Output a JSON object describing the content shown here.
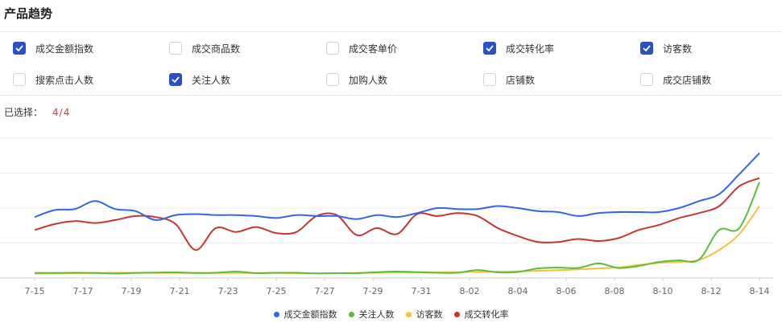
{
  "title": "产品趋势",
  "options": [
    {
      "label": "成交金额指数",
      "checked": true
    },
    {
      "label": "成交商品数",
      "checked": false
    },
    {
      "label": "成交客单价",
      "checked": false
    },
    {
      "label": "成交转化率",
      "checked": true
    },
    {
      "label": "访客数",
      "checked": true
    },
    {
      "label": "搜索点击人数",
      "checked": false
    },
    {
      "label": "关注人数",
      "checked": true
    },
    {
      "label": "加购人数",
      "checked": false
    },
    {
      "label": "店铺数",
      "checked": false
    },
    {
      "label": "成交店铺数",
      "checked": false
    }
  ],
  "selection": {
    "label": "已选择：",
    "count": "4/4"
  },
  "colors": {
    "checkbox": "#2a50c8",
    "count": "#e0383e"
  },
  "chart_data": {
    "type": "line",
    "x_tick_labels": [
      "7-15",
      "7-17",
      "7-19",
      "7-21",
      "7-23",
      "7-25",
      "7-27",
      "7-29",
      "7-31",
      "8-02",
      "8-04",
      "8-06",
      "8-08",
      "8-10",
      "8-12",
      "8-14"
    ],
    "grid": true,
    "legend_position": "bottom",
    "series": [
      {
        "name": "成交金额指数",
        "color": "#3366e6",
        "values": [
          30.5,
          34,
          34.5,
          38.5,
          34.5,
          33.5,
          29,
          31.5,
          32,
          31.5,
          31.5,
          31,
          30,
          31.5,
          31,
          31,
          29.5,
          31.5,
          30.5,
          32.5,
          35,
          34.5,
          34.5,
          36,
          35,
          33.5,
          33,
          31,
          32.5,
          33,
          33,
          33,
          35,
          38.5,
          42,
          52,
          62.5
        ]
      },
      {
        "name": "关注人数",
        "color": "#5bbd3c",
        "values": [
          2.5,
          2.5,
          2.6,
          2.5,
          2.2,
          2.5,
          2.7,
          2.8,
          2.5,
          2.6,
          3.2,
          2.4,
          2.6,
          2.6,
          2.3,
          2.4,
          2.4,
          2.9,
          3.2,
          2.9,
          2.6,
          2.6,
          4,
          2.8,
          3,
          4.8,
          5.2,
          5,
          7.3,
          5,
          6,
          8,
          8.8,
          9.2,
          24,
          25,
          48
        ]
      },
      {
        "name": "访客数",
        "color": "#f2c33a",
        "values": [
          2.2,
          2.3,
          2.4,
          2.5,
          2.6,
          2.6,
          2.5,
          2.5,
          2.5,
          2.5,
          2.5,
          2.5,
          2.5,
          2.4,
          2.3,
          2.4,
          2.5,
          2.6,
          2.7,
          2.7,
          2.8,
          2.9,
          3,
          3.1,
          3.3,
          3.6,
          3.9,
          4.3,
          4.8,
          5.3,
          6.5,
          7.5,
          8,
          9,
          14,
          22,
          36
        ]
      },
      {
        "name": "成交转化率",
        "color": "#c8352d",
        "values": [
          24,
          27,
          28.5,
          27.5,
          29,
          31,
          30.5,
          27,
          14,
          25,
          23,
          25.5,
          22.5,
          23,
          31,
          31.5,
          21.5,
          25,
          22,
          32,
          31,
          32.5,
          31,
          25,
          21,
          18,
          18,
          19.5,
          18.5,
          20,
          24,
          26.5,
          30,
          32.5,
          36,
          46,
          50
        ]
      }
    ],
    "ylim": [
      0,
      70
    ]
  }
}
